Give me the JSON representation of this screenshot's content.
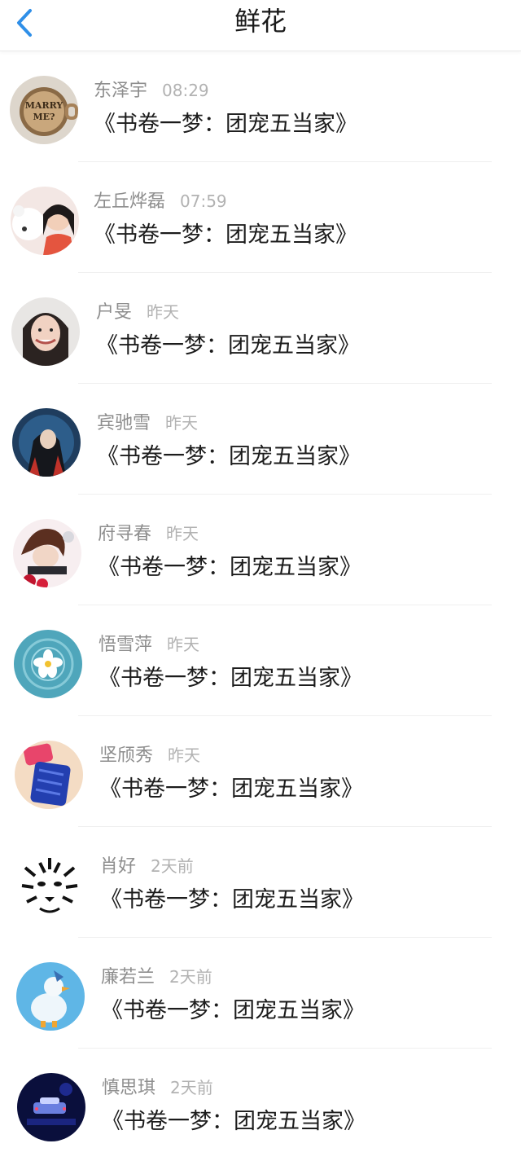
{
  "header": {
    "title": "鲜花",
    "back_icon": "chevron-left-icon",
    "accent": "#2f8fe8"
  },
  "items": [
    {
      "name": "东泽宇",
      "time": "08:29",
      "title": "《书卷一梦：团宠五当家》",
      "avatar": "marry-me-mug"
    },
    {
      "name": "左丘烨磊",
      "time": "07:59",
      "title": "《书卷一梦：团宠五当家》",
      "avatar": "girl-with-teddy-bear"
    },
    {
      "name": "户旻",
      "time": "昨天",
      "title": "《书卷一梦：团宠五当家》",
      "avatar": "smiling-girl-portrait"
    },
    {
      "name": "宾驰雪",
      "time": "昨天",
      "title": "《书卷一梦：团宠五当家》",
      "avatar": "anime-ninja"
    },
    {
      "name": "府寻春",
      "time": "昨天",
      "title": "《书卷一梦：团宠五当家》",
      "avatar": "anime-boy-roses"
    },
    {
      "name": "悟雪萍",
      "time": "昨天",
      "title": "《书卷一梦：团宠五当家》",
      "avatar": "flower-on-water"
    },
    {
      "name": "坚颀秀",
      "time": "昨天",
      "title": "《书卷一梦：团宠五当家》",
      "avatar": "phone-cases"
    },
    {
      "name": "肖好",
      "time": "2天前",
      "title": "《书卷一梦：团宠五当家》",
      "avatar": "tiger-sketch"
    },
    {
      "name": "廉若兰",
      "time": "2天前",
      "title": "《书卷一梦：团宠五当家》",
      "avatar": "duck-toy"
    },
    {
      "name": "慎思琪",
      "time": "2天前",
      "title": "《书卷一梦：团宠五当家》",
      "avatar": "night-scene"
    }
  ]
}
